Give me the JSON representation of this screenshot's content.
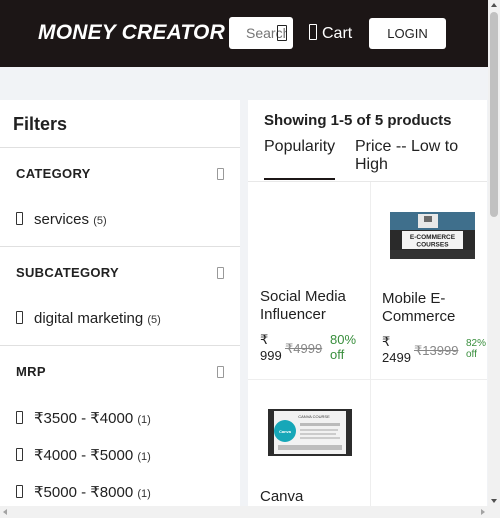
{
  "header": {
    "brand": "MONEY CREATOR",
    "search_placeholder": "Search",
    "cart_label": "Cart",
    "login_label": "LOGIN",
    "search_icon": "search-icon",
    "cart_icon": "cart-icon"
  },
  "filters": {
    "title": "Filters",
    "category": {
      "label": "CATEGORY",
      "options": [
        {
          "label": "services",
          "count": "(5)"
        }
      ]
    },
    "subcategory": {
      "label": "SUBCATEGORY",
      "options": [
        {
          "label": "digital marketing",
          "count": "(5)"
        }
      ]
    },
    "mrp": {
      "label": "MRP",
      "options": [
        {
          "label": "₹3500 - ₹4000",
          "count": "(1)"
        },
        {
          "label": "₹4000 - ₹5000",
          "count": "(1)"
        },
        {
          "label": "₹5000 - ₹8000",
          "count": "(1)"
        }
      ]
    }
  },
  "products": {
    "showing": "Showing 1-5 of 5 products",
    "sort_tabs": [
      "Popularity",
      "Price -- Low to High"
    ],
    "active_sort": "Popularity",
    "items": [
      {
        "name": "Social Media Influencer",
        "price_symbol": "₹",
        "price": "999",
        "mrp": "₹4999",
        "off": "80% off"
      },
      {
        "name": "Mobile E-Commerce",
        "price_symbol": "₹",
        "price": "2499",
        "mrp": "₹13999",
        "off": "82% off",
        "thumb_text": "E-COMMERCE COURSES"
      },
      {
        "name": "Canva",
        "thumb_text": "CANVA COURSE"
      }
    ]
  },
  "colors": {
    "header_bg": "#1c1616",
    "discount_green": "#388e3c",
    "page_bg": "#f1f3f6"
  }
}
